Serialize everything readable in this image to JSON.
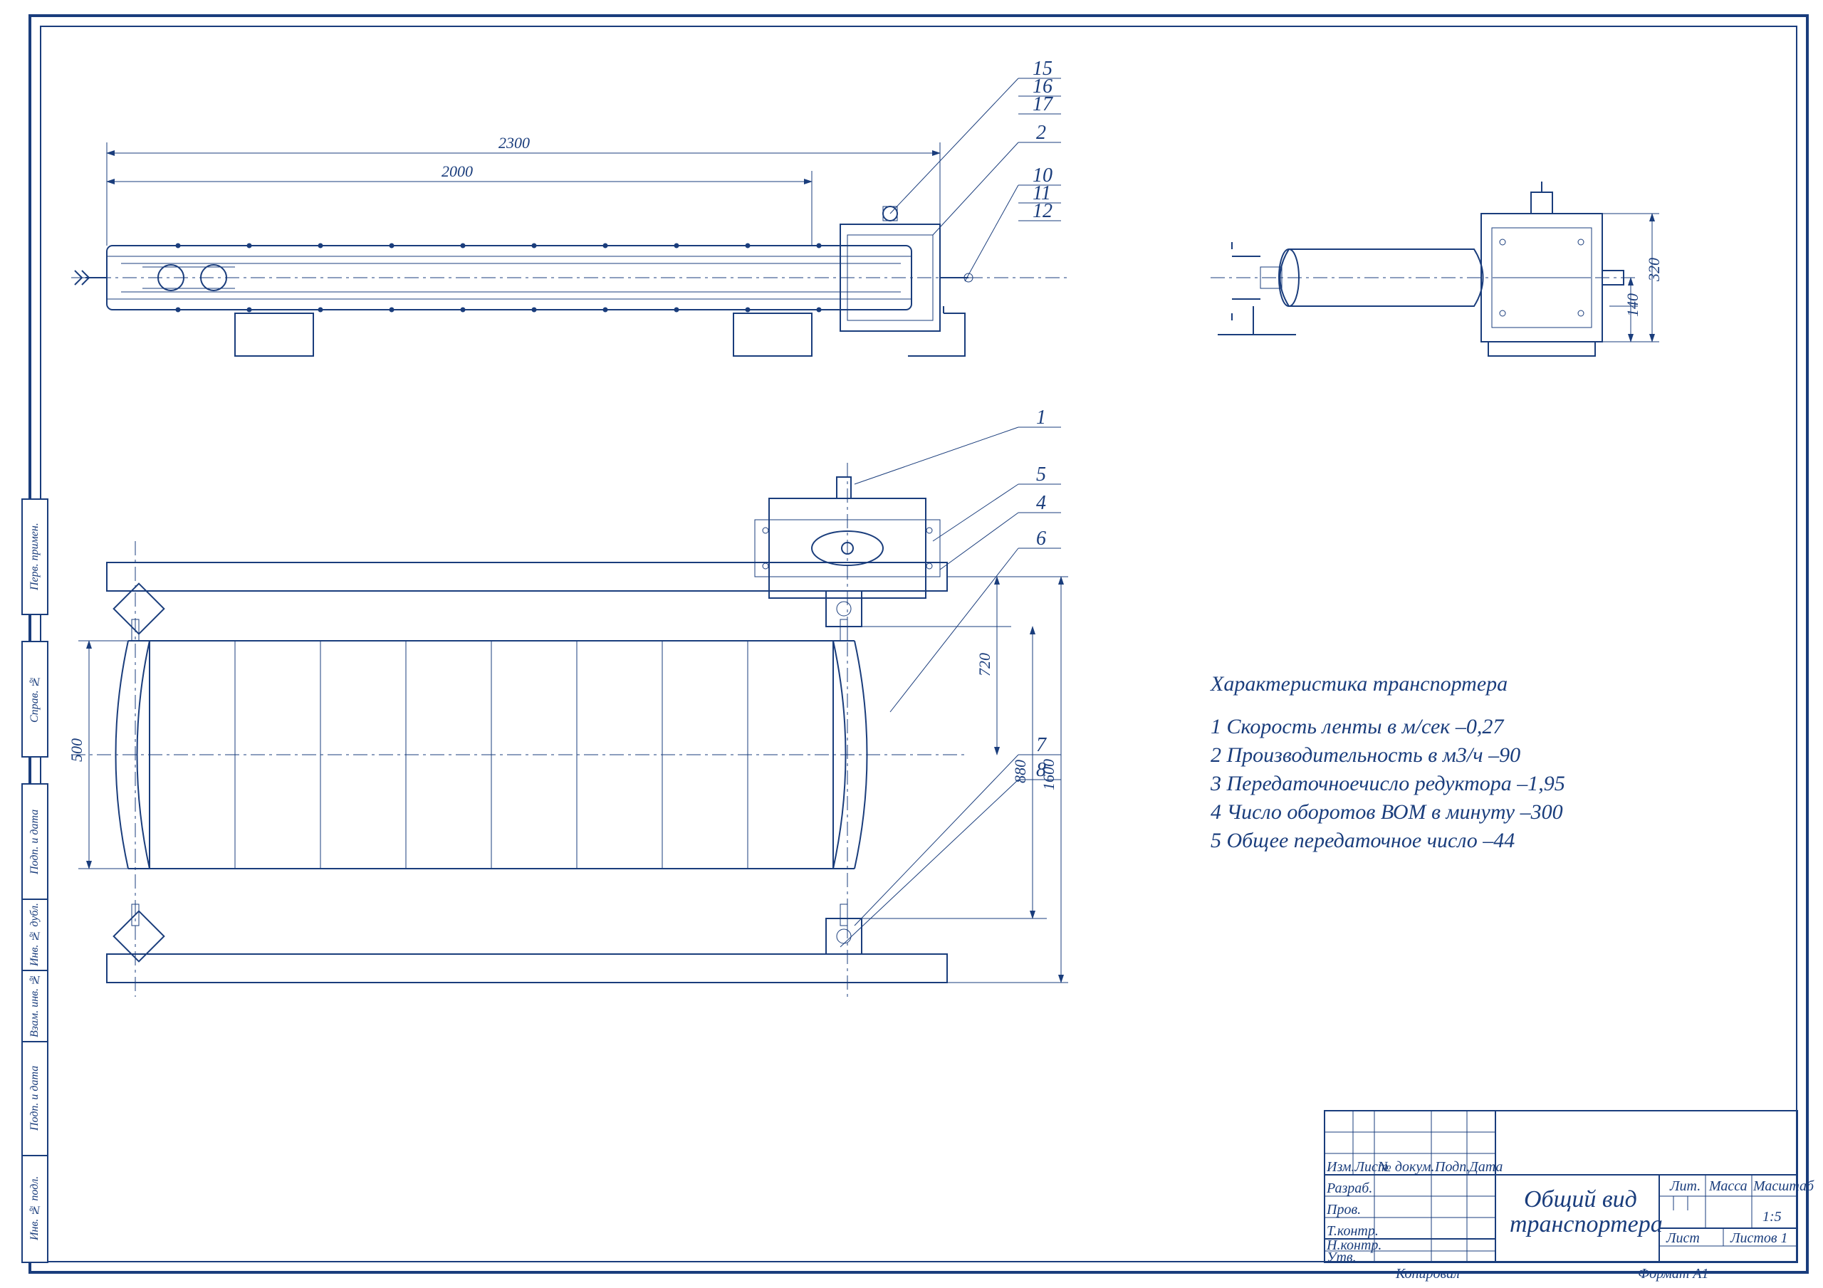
{
  "dimensions": {
    "d2300": "2300",
    "d2000": "2000",
    "d320": "320",
    "d140": "140",
    "d500": "500",
    "d720": "720",
    "d880": "880",
    "d1600": "1600"
  },
  "callouts": {
    "c1": "1",
    "c2": "2",
    "c4": "4",
    "c5": "5",
    "c6": "6",
    "c7": "7",
    "c8": "8",
    "c10": "10",
    "c11": "11",
    "c12": "12",
    "c15": "15",
    "c16": "16",
    "c17": "17"
  },
  "spec": {
    "title": "Характеристика транспортера",
    "l1": "1 Скорость ленты в м/сек –0,27",
    "l2": "2 Производительность в м3/ч –90",
    "l3": "3 Передаточноечисло редуктора –1,95",
    "l4": "4 Число оборотов ВОМ в минуту –300",
    "l5": "5 Общее передаточное число –44"
  },
  "titleblock": {
    "title1": "Общий вид",
    "title2": "транспортера",
    "h_izm": "Изм.Лист",
    "h_dok": "№ докум.",
    "h_podp": "Подп.",
    "h_data": "Дата",
    "r_razrab": "Разраб.",
    "r_prov": "Пров.",
    "r_tkontr": "Т.контр.",
    "r_nkontr": "Н.контр.",
    "r_utv": "Утв.",
    "lit": "Лит.",
    "massa": "Масса",
    "masshtab": "Масштаб",
    "scale": "1:5",
    "list": "Лист",
    "listov": "Листов   1",
    "kopiroval": "Копировал",
    "format": "Формат    А1"
  },
  "sideblocks": {
    "s1": "Инв. № подл.",
    "s2": "Подп. и дата",
    "s3": "Взам. инв. №",
    "s4": "Инв. № дубл.",
    "s5": "Подп. и дата",
    "s6": "Справ. №",
    "s7": "Перв. примен."
  }
}
